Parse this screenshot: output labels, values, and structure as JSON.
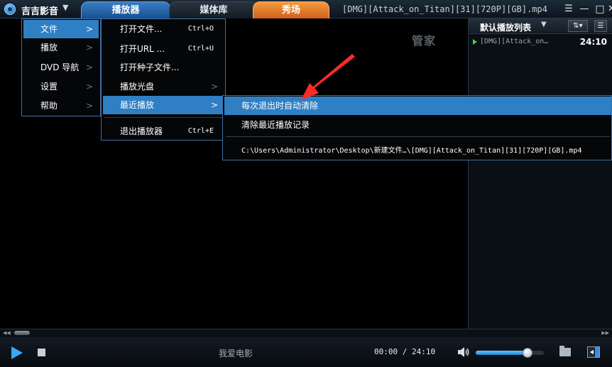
{
  "app": {
    "name": "吉吉影音",
    "window_title": "[DMG][Attack_on_Titan][31][720P][GB].mp4"
  },
  "tabs": [
    {
      "label": "播放器",
      "active": true
    },
    {
      "label": "媒体库",
      "active": false
    },
    {
      "label": "秀场",
      "active": false
    }
  ],
  "window_controls": {
    "menu": "☰",
    "minimize": "—",
    "maximize": "□",
    "close": "✕"
  },
  "watermark": "管家",
  "main_menu": [
    {
      "label": "文件",
      "active": true
    },
    {
      "label": "播放",
      "active": false
    },
    {
      "label": "DVD 导航",
      "active": false
    },
    {
      "label": "设置",
      "active": false
    },
    {
      "label": "帮助",
      "active": false
    }
  ],
  "file_menu": [
    {
      "label": "打开文件...",
      "shortcut": "Ctrl+O"
    },
    {
      "label": "打开URL ...",
      "shortcut": "Ctrl+U"
    },
    {
      "label": "打开种子文件...",
      "shortcut": ""
    },
    {
      "label": "播放光盘",
      "shortcut": ""
    },
    {
      "label": "最近播放",
      "shortcut": ""
    },
    {
      "label": "退出播放器",
      "shortcut": "Ctrl+E"
    }
  ],
  "recent_menu": [
    {
      "label": "每次退出时自动清除"
    },
    {
      "label": "清除最近播放记录"
    },
    {
      "label": "C:\\Users\\Administrator\\Desktop\\新建文件…\\[DMG][Attack_on_Titan][31][720P][GB].mp4"
    }
  ],
  "playlist": {
    "title": "默认播放列表",
    "items": [
      {
        "name": "[DMG][Attack_on…",
        "duration": "24:10",
        "playing": true
      }
    ]
  },
  "controls": {
    "ticker": "我爱电影",
    "time": "00:00 / 24:10",
    "volume_fraction": 0.7,
    "seek_fraction": 0.0
  },
  "colors": {
    "accent": "#2f7fc4",
    "menu_border": "#3c6fa3",
    "orange_tab": "#f39a3f",
    "play_indicator": "#3ed63e",
    "annotation_arrow": "#ff2a2a"
  }
}
